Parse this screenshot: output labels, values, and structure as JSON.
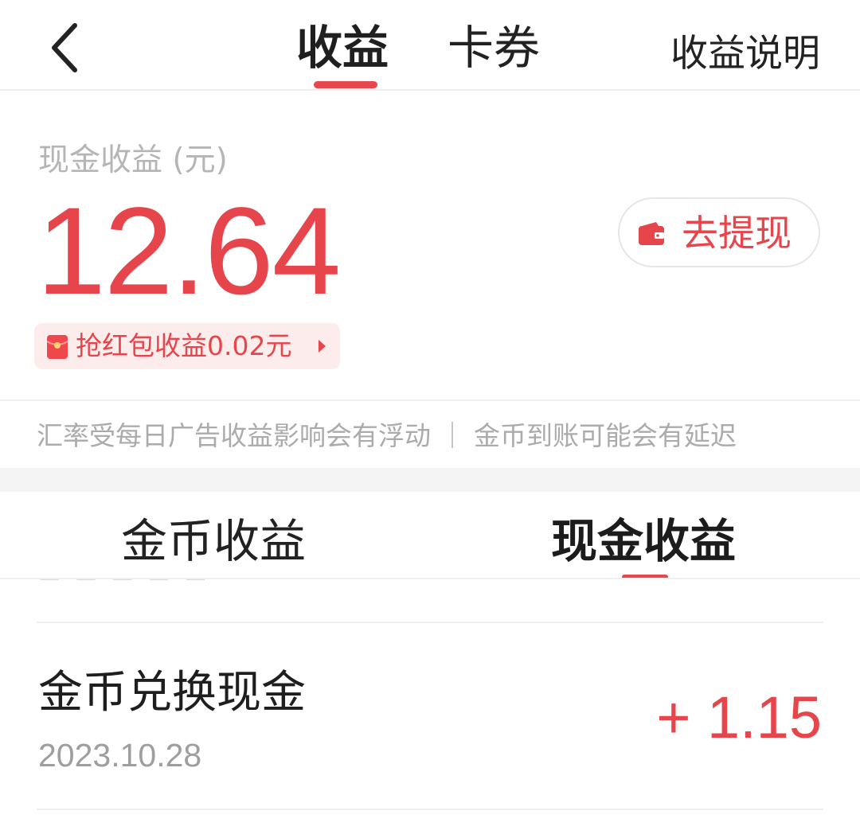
{
  "header": {
    "tabs": [
      {
        "label": "收益",
        "active": true
      },
      {
        "label": "卡券",
        "active": false
      }
    ],
    "explain_label": "收益说明"
  },
  "summary": {
    "cash_label": "现金收益 (元)",
    "cash_amount": "12.64",
    "withdraw_label": "去提现",
    "red_packet_text": "抢红包收益0.02元",
    "notice": "汇率受每日广告收益影响会有浮动 ｜ 金币到账可能会有延迟"
  },
  "sub_tabs": [
    {
      "label": "金币收益",
      "active": false
    },
    {
      "label": "现金收益",
      "active": true
    }
  ],
  "records": [
    {
      "title": "金币兑换现金",
      "date": "2023.10.28",
      "amount": "+ 1.15"
    }
  ],
  "colors": {
    "accent": "#e6454b",
    "muted_text": "#ababab",
    "primary_text": "#222222"
  },
  "icons": [
    "chevron-left-icon",
    "wallet-icon",
    "red-packet-icon",
    "triangle-right-icon"
  ]
}
